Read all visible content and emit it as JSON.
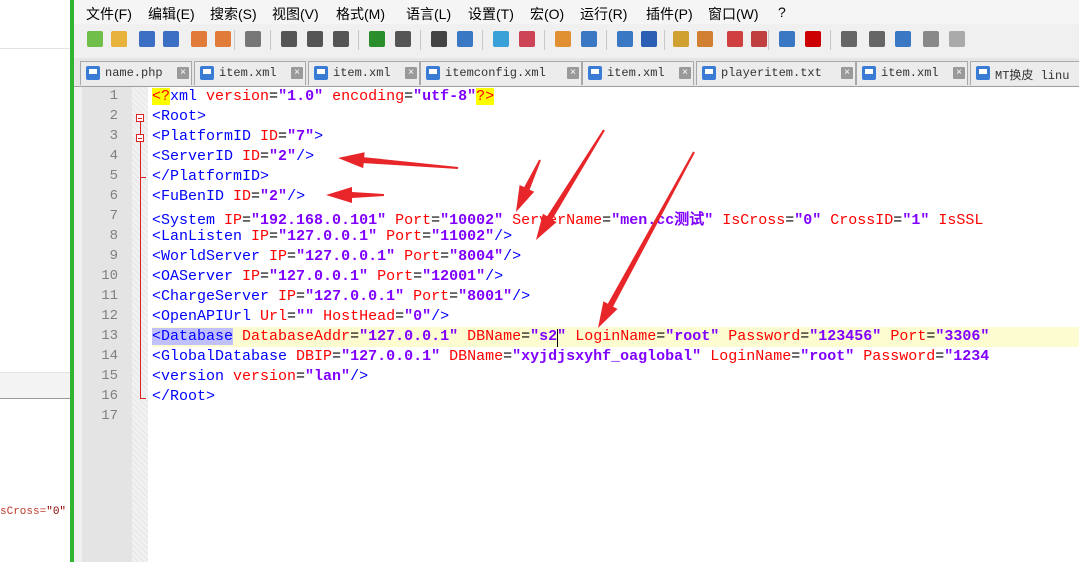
{
  "background_window": {
    "text_fragment_attr": "sCross=",
    "text_fragment_value": "\"0\""
  },
  "menubar": {
    "items": [
      "文件(F)",
      "编辑(E)",
      "搜索(S)",
      "视图(V)",
      "格式(M)",
      "语言(L)",
      "设置(T)",
      "宏(O)",
      "运行(R)",
      "插件(P)",
      "窗口(W)",
      "?"
    ]
  },
  "toolbar": {
    "icons": [
      "new-file-icon",
      "open-file-icon",
      "save-icon",
      "save-all-icon",
      "close-icon",
      "close-all-icon",
      "print-icon",
      "cut-icon",
      "copy-icon",
      "paste-icon",
      "undo-icon",
      "redo-icon",
      "find-icon",
      "replace-icon",
      "zoom-in-icon",
      "zoom-out-icon",
      "sync-vertical-icon",
      "sync-horizontal-icon",
      "word-wrap-icon",
      "show-all-chars-icon",
      "indent-guide-icon",
      "udl-icon",
      "doc-map-icon",
      "function-list-icon",
      "folder-workspace-icon",
      "monitoring-icon",
      "record-macro-icon",
      "stop-macro-icon",
      "play-macro-icon",
      "run-macro-multiple-icon",
      "save-macro-icon"
    ]
  },
  "tabs": [
    {
      "label": "name.php"
    },
    {
      "label": "item.xml"
    },
    {
      "label": "item.xml"
    },
    {
      "label": "itemconfig.xml"
    },
    {
      "label": "item.xml"
    },
    {
      "label": "playeritem.txt"
    },
    {
      "label": "item.xml"
    },
    {
      "label": "MT换皮 linu"
    }
  ],
  "editor": {
    "line_numbers": [
      "1",
      "2",
      "3",
      "4",
      "5",
      "6",
      "7",
      "8",
      "9",
      "10",
      "11",
      "12",
      "13",
      "14",
      "15",
      "16",
      "17"
    ],
    "lines": [
      [
        [
          "pi",
          "<?"
        ],
        [
          "tg",
          "xml "
        ],
        [
          "at",
          "version"
        ],
        [
          "eq",
          "="
        ],
        [
          "sv",
          "\"1.0\""
        ],
        [
          "tg",
          " "
        ],
        [
          "at",
          "encoding"
        ],
        [
          "eq",
          "="
        ],
        [
          "sv",
          "\"utf-8\""
        ],
        [
          "pi",
          "?>"
        ]
      ],
      [
        [
          "tg",
          "<Root>"
        ]
      ],
      [
        [
          "tg",
          "<PlatformID "
        ],
        [
          "at",
          "ID"
        ],
        [
          "eq",
          "="
        ],
        [
          "sv",
          "\"7\""
        ],
        [
          "tg",
          ">"
        ]
      ],
      [
        [
          "tg",
          "<ServerID "
        ],
        [
          "at",
          "ID"
        ],
        [
          "eq",
          "="
        ],
        [
          "sv",
          "\"2\""
        ],
        [
          "tg",
          "/>"
        ]
      ],
      [
        [
          "tg",
          "</PlatformID>"
        ]
      ],
      [
        [
          "tg",
          "<FuBenID "
        ],
        [
          "at",
          "ID"
        ],
        [
          "eq",
          "="
        ],
        [
          "sv",
          "\"2\""
        ],
        [
          "tg",
          "/>"
        ]
      ],
      [
        [
          "tg",
          "<System "
        ],
        [
          "at",
          "IP"
        ],
        [
          "eq",
          "="
        ],
        [
          "sv",
          "\"192.168.0.101\""
        ],
        [
          "tg",
          " "
        ],
        [
          "at",
          "Port"
        ],
        [
          "eq",
          "="
        ],
        [
          "sv",
          "\"10002\""
        ],
        [
          "tg",
          " "
        ],
        [
          "at",
          "ServerName"
        ],
        [
          "eq",
          "="
        ],
        [
          "sv",
          "\"men.cc测试\""
        ],
        [
          "tg",
          " "
        ],
        [
          "at",
          "IsCross"
        ],
        [
          "eq",
          "="
        ],
        [
          "sv",
          "\"0\""
        ],
        [
          "tg",
          " "
        ],
        [
          "at",
          "CrossID"
        ],
        [
          "eq",
          "="
        ],
        [
          "sv",
          "\"1\""
        ],
        [
          "tg",
          " "
        ],
        [
          "at",
          "IsSSL"
        ]
      ],
      [
        [
          "tg",
          "<LanListen "
        ],
        [
          "at",
          "IP"
        ],
        [
          "eq",
          "="
        ],
        [
          "sv",
          "\"127.0.0.1\""
        ],
        [
          "tg",
          " "
        ],
        [
          "at",
          "Port"
        ],
        [
          "eq",
          "="
        ],
        [
          "sv",
          "\"11002\""
        ],
        [
          "tg",
          "/>"
        ]
      ],
      [
        [
          "tg",
          "<WorldServer "
        ],
        [
          "at",
          "IP"
        ],
        [
          "eq",
          "="
        ],
        [
          "sv",
          "\"127.0.0.1\""
        ],
        [
          "tg",
          " "
        ],
        [
          "at",
          "Port"
        ],
        [
          "eq",
          "="
        ],
        [
          "sv",
          "\"8004\""
        ],
        [
          "tg",
          "/>"
        ]
      ],
      [
        [
          "tg",
          "<OAServer "
        ],
        [
          "at",
          "IP"
        ],
        [
          "eq",
          "="
        ],
        [
          "sv",
          "\"127.0.0.1\""
        ],
        [
          "tg",
          " "
        ],
        [
          "at",
          "Port"
        ],
        [
          "eq",
          "="
        ],
        [
          "sv",
          "\"12001\""
        ],
        [
          "tg",
          "/>"
        ]
      ],
      [
        [
          "tg",
          "<ChargeServer "
        ],
        [
          "at",
          "IP"
        ],
        [
          "eq",
          "="
        ],
        [
          "sv",
          "\"127.0.0.1\""
        ],
        [
          "tg",
          " "
        ],
        [
          "at",
          "Port"
        ],
        [
          "eq",
          "="
        ],
        [
          "sv",
          "\"8001\""
        ],
        [
          "tg",
          "/>"
        ]
      ],
      [
        [
          "tg",
          "<OpenAPIUrl "
        ],
        [
          "at",
          "Url"
        ],
        [
          "eq",
          "="
        ],
        [
          "sv",
          "\"\""
        ],
        [
          "tg",
          " "
        ],
        [
          "at",
          "HostHead"
        ],
        [
          "eq",
          "="
        ],
        [
          "sv",
          "\"0\""
        ],
        [
          "tg",
          "/>"
        ]
      ],
      [
        [
          "hlw",
          "<Database"
        ],
        [
          "tg",
          " "
        ],
        [
          "at",
          "DatabaseAddr"
        ],
        [
          "eq",
          "="
        ],
        [
          "sv",
          "\"127.0.0.1\""
        ],
        [
          "tg",
          " "
        ],
        [
          "at",
          "DBName"
        ],
        [
          "eq",
          "="
        ],
        [
          "sv",
          "\"s2\""
        ],
        [
          "tg",
          " "
        ],
        [
          "at",
          "LoginName"
        ],
        [
          "eq",
          "="
        ],
        [
          "sv",
          "\"root\""
        ],
        [
          "tg",
          " "
        ],
        [
          "at",
          "Password"
        ],
        [
          "eq",
          "="
        ],
        [
          "sv",
          "\"123456\""
        ],
        [
          "tg",
          " "
        ],
        [
          "at",
          "Port"
        ],
        [
          "eq",
          "="
        ],
        [
          "sv",
          "\"3306\""
        ]
      ],
      [
        [
          "tg",
          "<GlobalDatabase "
        ],
        [
          "at",
          "DBIP"
        ],
        [
          "eq",
          "="
        ],
        [
          "sv",
          "\"127.0.0.1\""
        ],
        [
          "tg",
          " "
        ],
        [
          "at",
          "DBName"
        ],
        [
          "eq",
          "="
        ],
        [
          "sv",
          "\"xyjdjsxyhf_oaglobal\""
        ],
        [
          "tg",
          " "
        ],
        [
          "at",
          "LoginName"
        ],
        [
          "eq",
          "="
        ],
        [
          "sv",
          "\"root\""
        ],
        [
          "tg",
          " "
        ],
        [
          "at",
          "Password"
        ],
        [
          "eq",
          "="
        ],
        [
          "sv",
          "\"1234"
        ]
      ],
      [
        [
          "tg",
          "<version "
        ],
        [
          "at",
          "version"
        ],
        [
          "eq",
          "="
        ],
        [
          "sv",
          "\"lan\""
        ],
        [
          "tg",
          "/>"
        ]
      ],
      [
        [
          "tg",
          "</Root>"
        ]
      ],
      []
    ]
  },
  "colors": {
    "annotation_arrow": "#e8262a",
    "tag": "#0000ff",
    "attribute": "#ff0000",
    "string_value": "#8000ff",
    "pi_highlight": "#ffff00",
    "current_line": "#fdfbd0",
    "selected_word": "#c0c0ff"
  }
}
